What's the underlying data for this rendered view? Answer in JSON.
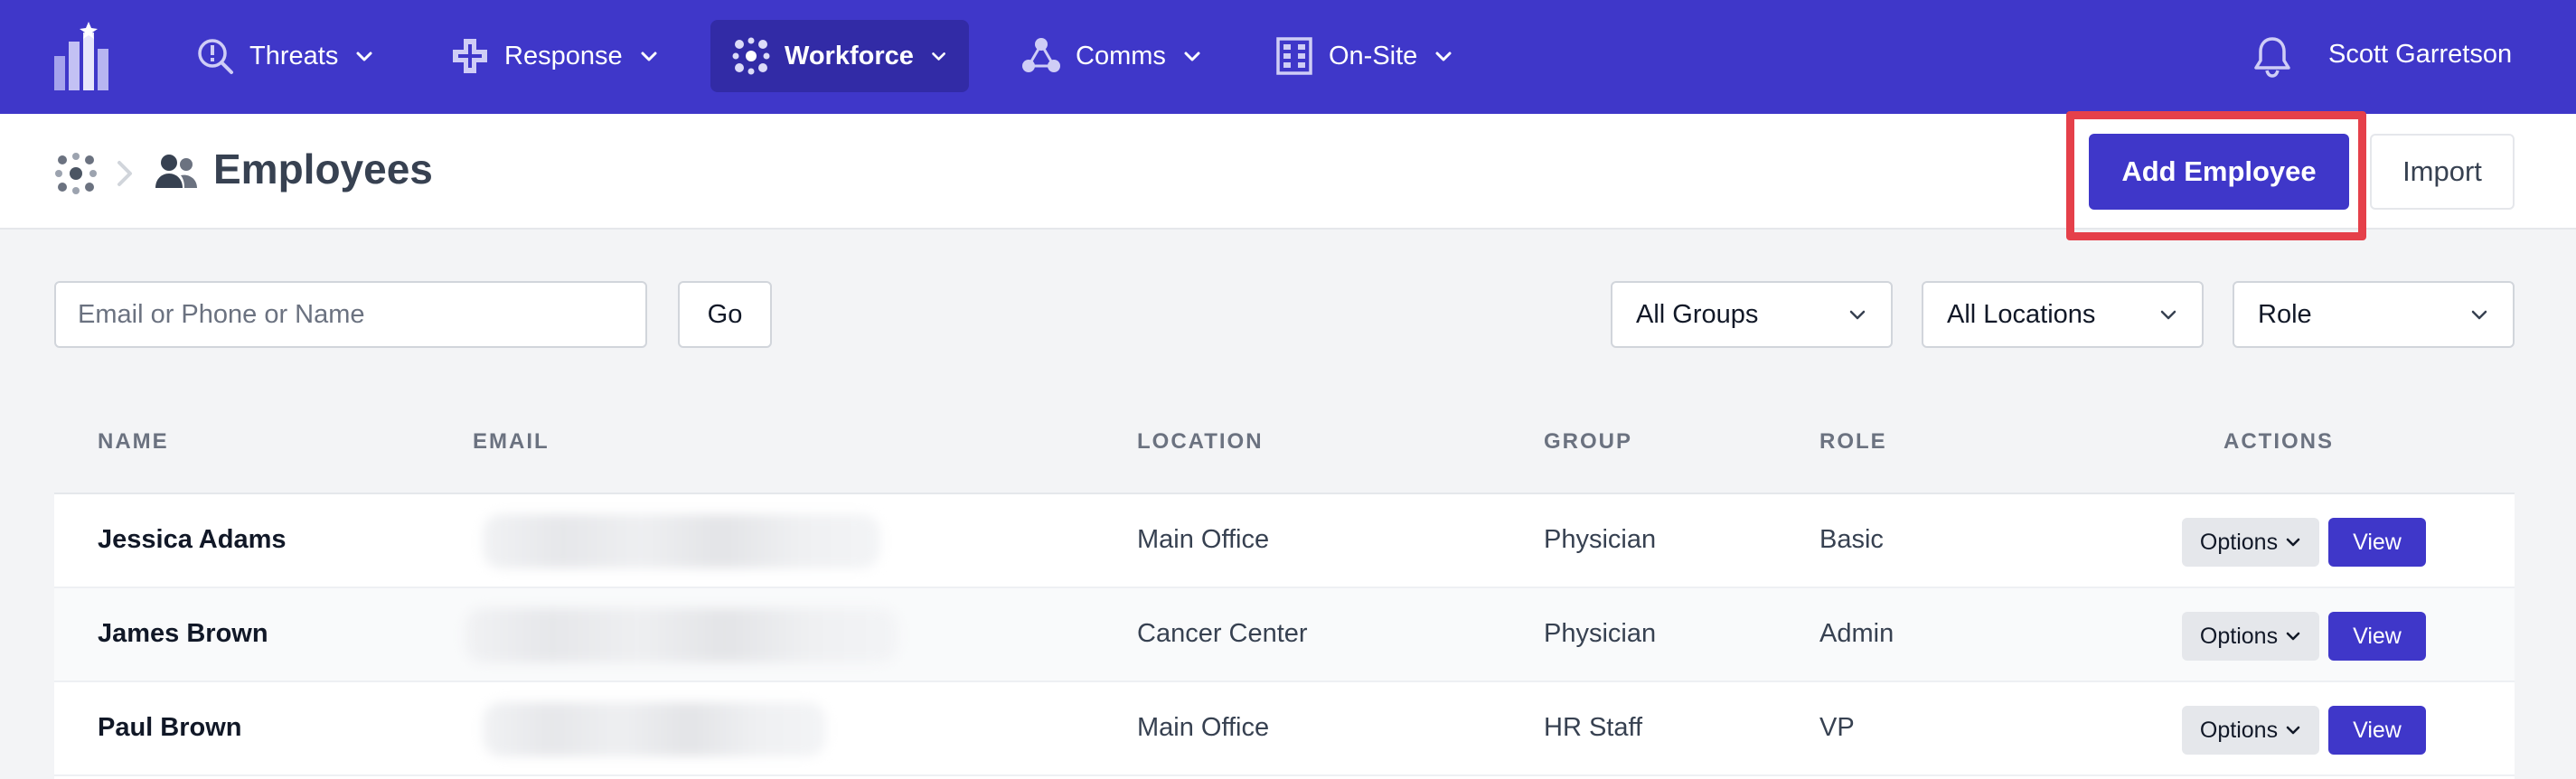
{
  "nav": {
    "items": [
      {
        "label": "Threats",
        "icon": "search-alert-icon"
      },
      {
        "label": "Response",
        "icon": "medical-cross-icon"
      },
      {
        "label": "Workforce",
        "icon": "dots-grid-icon",
        "active": true
      },
      {
        "label": "Comms",
        "icon": "network-triangle-icon"
      },
      {
        "label": "On-Site",
        "icon": "building-icon"
      }
    ],
    "user_name": "Scott Garretson"
  },
  "header": {
    "title": "Employees",
    "add_label": "Add Employee",
    "import_label": "Import"
  },
  "filters": {
    "search_placeholder": "Email or Phone or Name",
    "go_label": "Go",
    "groups": "All Groups",
    "locations": "All Locations",
    "role": "Role"
  },
  "table": {
    "columns": [
      "NAME",
      "EMAIL",
      "LOCATION",
      "GROUP",
      "ROLE",
      "ACTIONS"
    ],
    "rows": [
      {
        "name": "Jessica Adams",
        "location": "Main Office",
        "group": "Physician",
        "role": "Basic"
      },
      {
        "name": "James Brown",
        "location": "Cancer Center",
        "group": "Physician",
        "role": "Admin"
      },
      {
        "name": "Paul Brown",
        "location": "Main Office",
        "group": "HR Staff",
        "role": "VP"
      }
    ],
    "options_label": "Options",
    "view_label": "View"
  },
  "colors": {
    "brand": "#3f37c9",
    "highlight": "#e5404a"
  }
}
